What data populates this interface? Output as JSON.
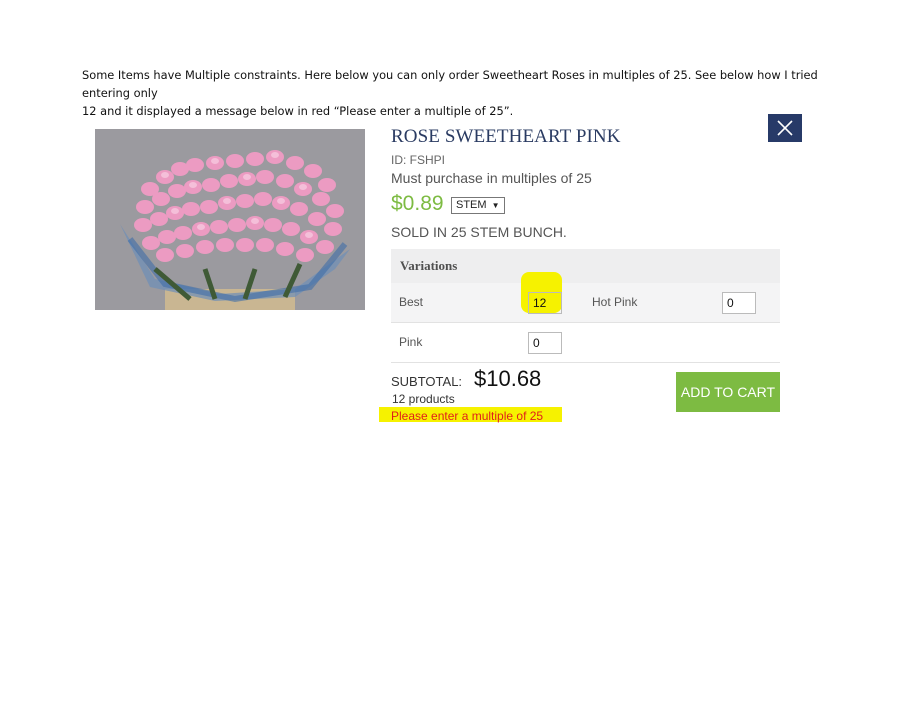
{
  "intro": {
    "line1": "Some Items have Multiple constraints.  Here below you can only order Sweetheart Roses in multiples of 25.  See below how I tried entering only",
    "line2": "12 and it displayed a message below in red “Please enter a multiple of 25”."
  },
  "product": {
    "title": "ROSE SWEETHEART PINK",
    "id_label": "ID: FSHPI",
    "constraint": "Must purchase in multiples of 25",
    "price": "$0.89",
    "unit": "STEM",
    "sold_in": "SOLD IN 25 STEM BUNCH."
  },
  "variations": {
    "header": "Variations",
    "items": [
      {
        "name": "Best",
        "qty": "12"
      },
      {
        "name": "Hot Pink",
        "qty": "0"
      },
      {
        "name": "Pink",
        "qty": "0"
      }
    ]
  },
  "summary": {
    "subtotal_label": "SUBTOTAL:",
    "subtotal_value": "$10.68",
    "product_count": "12 products",
    "error": "Please enter a multiple of 25"
  },
  "buttons": {
    "add_to_cart": "ADD TO CART"
  },
  "icons": {
    "close": "close-icon",
    "dropdown": "caret-down-icon"
  },
  "colors": {
    "accent_green": "#7dbb42",
    "navy": "#273a68",
    "error_red": "#e0201a",
    "highlight_yellow": "#f6f200"
  }
}
